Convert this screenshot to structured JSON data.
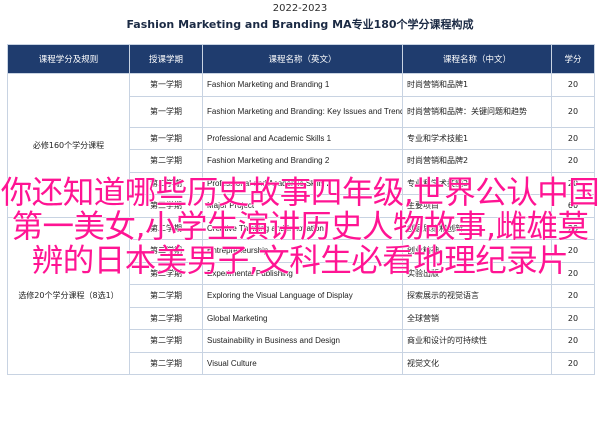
{
  "header": {
    "year": "2022-2023",
    "title": "Fashion Marketing and Branding MA专业180个学分课程构成"
  },
  "table": {
    "columns": [
      "课程学分及规则",
      "授课学期",
      "课程名称（英文）",
      "课程名称（中文）",
      "学分"
    ],
    "groups": [
      {
        "category": "必修160个学分课程",
        "rows": [
          {
            "term": "第一学期",
            "en": "Fashion Marketing and Branding 1",
            "zh": "时尚营销和品牌1",
            "credit": "20"
          },
          {
            "term": "第一学期",
            "en": "Fashion Marketing and Branding: Key Issues and Trends",
            "zh": "时尚营销和品牌：关键问题和趋势",
            "credit": "20"
          },
          {
            "term": "第一学期",
            "en": "Professional and Academic Skills 1",
            "zh": "专业和学术技能1",
            "credit": "20"
          },
          {
            "term": "第二学期",
            "en": "Fashion Marketing and Branding 2",
            "zh": "时尚营销和品牌2",
            "credit": "20"
          },
          {
            "term": "第二学期",
            "en": "Professional and Academic Skills 2",
            "zh": "专业和学术技能2",
            "credit": "20"
          },
          {
            "term": "第三学期",
            "en": "Major Project",
            "zh": "主要项目",
            "credit": "60"
          }
        ]
      },
      {
        "category": "选修20个学分课程（8选1）",
        "rows": [
          {
            "term": "第二学期",
            "en": "Creative Thinking and Innovation",
            "zh": "创意思维和创新",
            "credit": "20"
          },
          {
            "term": "第二学期",
            "en": "Entrepreneurship",
            "zh": "创业精神",
            "credit": "20"
          },
          {
            "term": "第二学期",
            "en": "Experimental Publishing",
            "zh": "实验出版",
            "credit": "20"
          },
          {
            "term": "第二学期",
            "en": "Exploring the Visual Language of Display",
            "zh": "探索展示的视觉语言",
            "credit": "20"
          },
          {
            "term": "第二学期",
            "en": "Global Marketing",
            "zh": "全球营销",
            "credit": "20"
          },
          {
            "term": "第二学期",
            "en": "Sustainability in Business and Design",
            "zh": "商业和设计的可持续性",
            "credit": "20"
          },
          {
            "term": "第二学期",
            "en": "Visual Culture",
            "zh": "视觉文化",
            "credit": "20"
          }
        ]
      }
    ]
  },
  "overlay": {
    "line1": "你还知道哪些历史故事四年级,世界公认中国",
    "line2": "第一美女,小学生演讲历史人物故事,雌雄莫",
    "line3": "辨的日本美男子,文科生必看地理纪录片"
  }
}
